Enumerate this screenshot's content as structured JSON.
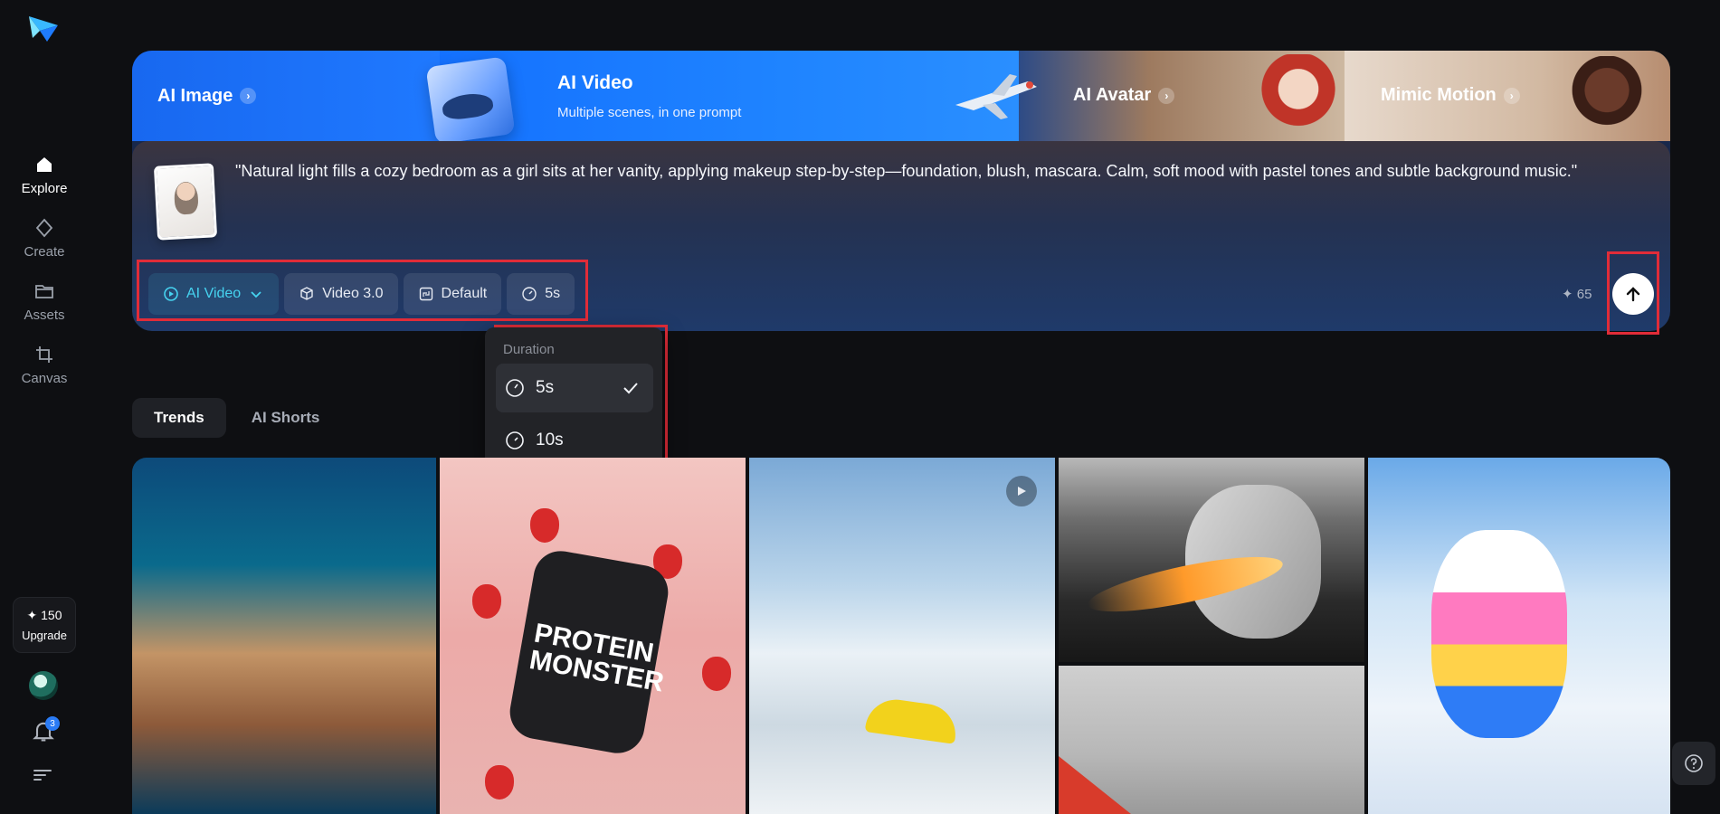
{
  "sidebar": {
    "nav": [
      {
        "label": "Explore",
        "icon": "home-icon",
        "active": true
      },
      {
        "label": "Create",
        "icon": "diamond-icon",
        "active": false
      },
      {
        "label": "Assets",
        "icon": "folder-icon",
        "active": false
      },
      {
        "label": "Canvas",
        "icon": "crop-icon",
        "active": false
      }
    ],
    "upgrade": {
      "credits": "✦ 150",
      "label": "Upgrade"
    },
    "notifications_count": "3"
  },
  "banner": {
    "tabs": {
      "ai_image": "AI Image",
      "ai_video": "AI Video",
      "ai_video_sub": "Multiple scenes, in one prompt",
      "ai_avatar": "AI Avatar",
      "mimic_motion": "Mimic Motion"
    }
  },
  "prompt": {
    "text": "\"Natural light fills a cozy bedroom as a girl sits at her vanity, applying makeup step-by-step—foundation, blush, mascara. Calm, soft mood with pastel tones and subtle background music.\"",
    "toolbar": {
      "mode": "AI Video",
      "model": "Video 3.0",
      "ratio": "Default",
      "duration": "5s"
    },
    "credits_cost": "✦ 65"
  },
  "duration_menu": {
    "header": "Duration",
    "options": [
      {
        "label": "5s",
        "selected": true
      },
      {
        "label": "10s",
        "selected": false
      }
    ]
  },
  "content_tabs": [
    {
      "label": "Trends",
      "active": true
    },
    {
      "label": "AI Shorts",
      "active": false
    }
  ],
  "gallery": {
    "jar_text": "PROTEIN MONSTER"
  },
  "colors": {
    "accent_cyan": "#46d3f0",
    "highlight_red": "#e12c38",
    "background": "#0e0f12"
  }
}
